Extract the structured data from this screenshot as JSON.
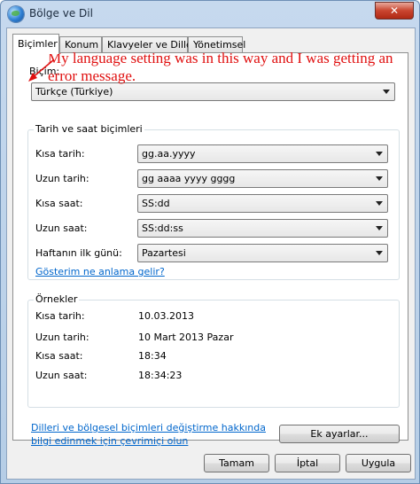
{
  "window": {
    "title": "Bölge ve Dil",
    "close_glyph": "✕"
  },
  "tabs": [
    {
      "label": "Biçimler",
      "active": true
    },
    {
      "label": "Konum",
      "active": false
    },
    {
      "label": "Klavyeler ve Diller",
      "active": false
    },
    {
      "label": "Yönetimsel",
      "active": false
    }
  ],
  "format": {
    "label": "Biçim:",
    "value": "Türkçe (Türkiye)"
  },
  "datetime_group": {
    "title": "Tarih ve saat biçimleri",
    "rows": [
      {
        "label": "Kısa tarih:",
        "value": "gg.aa.yyyy"
      },
      {
        "label": "Uzun tarih:",
        "value": "gg aaaa yyyy gggg"
      },
      {
        "label": "Kısa saat:",
        "value": "SS:dd"
      },
      {
        "label": "Uzun saat:",
        "value": "SS:dd:ss"
      },
      {
        "label": "Haftanın ilk günü:",
        "value": "Pazartesi"
      }
    ],
    "notation_link": "Gösterim ne anlama gelir?"
  },
  "examples_group": {
    "title": "Örnekler",
    "rows": [
      {
        "label": "Kısa tarih:",
        "value": "10.03.2013"
      },
      {
        "label": "Uzun tarih:",
        "value": "10 Mart 2013 Pazar"
      },
      {
        "label": "Kısa saat:",
        "value": "18:34"
      },
      {
        "label": "Uzun saat:",
        "value": "18:34:23"
      }
    ]
  },
  "info_link": {
    "line1": "Dilleri ve bölgesel biçimleri değiştirme hakkında",
    "line2": "bilgi edinmek için çevrimiçi olun"
  },
  "buttons": {
    "additional": "Ek ayarlar...",
    "ok": "Tamam",
    "cancel": "İptal",
    "apply": "Uygula"
  },
  "annotation": {
    "text": "My language setting was in this way and I was getting an error message.",
    "color": "#e01010"
  }
}
